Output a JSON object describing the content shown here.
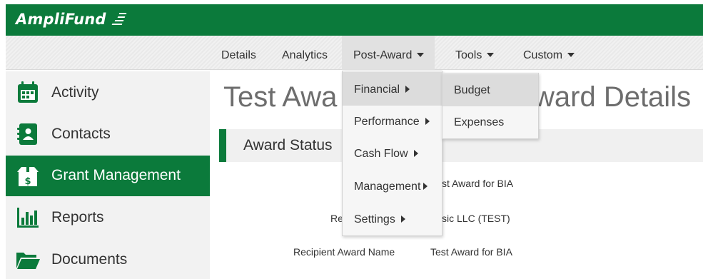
{
  "app": {
    "name": "AmpliFund"
  },
  "nav": {
    "items": [
      {
        "label": "Details"
      },
      {
        "label": "Analytics"
      },
      {
        "label": "Post-Award"
      },
      {
        "label": "Tools"
      },
      {
        "label": "Custom"
      }
    ]
  },
  "sidebar": {
    "items": [
      {
        "label": "Activity",
        "icon": "calendar-icon"
      },
      {
        "label": "Contacts",
        "icon": "contact-card-icon"
      },
      {
        "label": "Grant Management",
        "icon": "money-box-icon"
      },
      {
        "label": "Reports",
        "icon": "bar-chart-icon"
      },
      {
        "label": "Documents",
        "icon": "folder-open-icon"
      }
    ]
  },
  "page": {
    "title_left": "Test Awa",
    "title_right": "ward Details",
    "section_title": "Award Status",
    "fields": [
      {
        "label": "",
        "value": "st Award for BIA"
      },
      {
        "label": "Re",
        "value": "sic LLC (TEST)"
      },
      {
        "label": "Recipient Award Name",
        "value": "Test Award for BIA"
      }
    ]
  },
  "post_award_menu": {
    "items": [
      {
        "label": "Financial"
      },
      {
        "label": "Performance"
      },
      {
        "label": "Cash Flow"
      },
      {
        "label": "Management"
      },
      {
        "label": "Settings"
      }
    ]
  },
  "financial_submenu": {
    "items": [
      {
        "label": "Budget"
      },
      {
        "label": "Expenses"
      }
    ]
  },
  "colors": {
    "brand_green": "#0b7a3b",
    "menu_bg": "#f6f6f6",
    "hover_bg": "#dcdcdc"
  }
}
